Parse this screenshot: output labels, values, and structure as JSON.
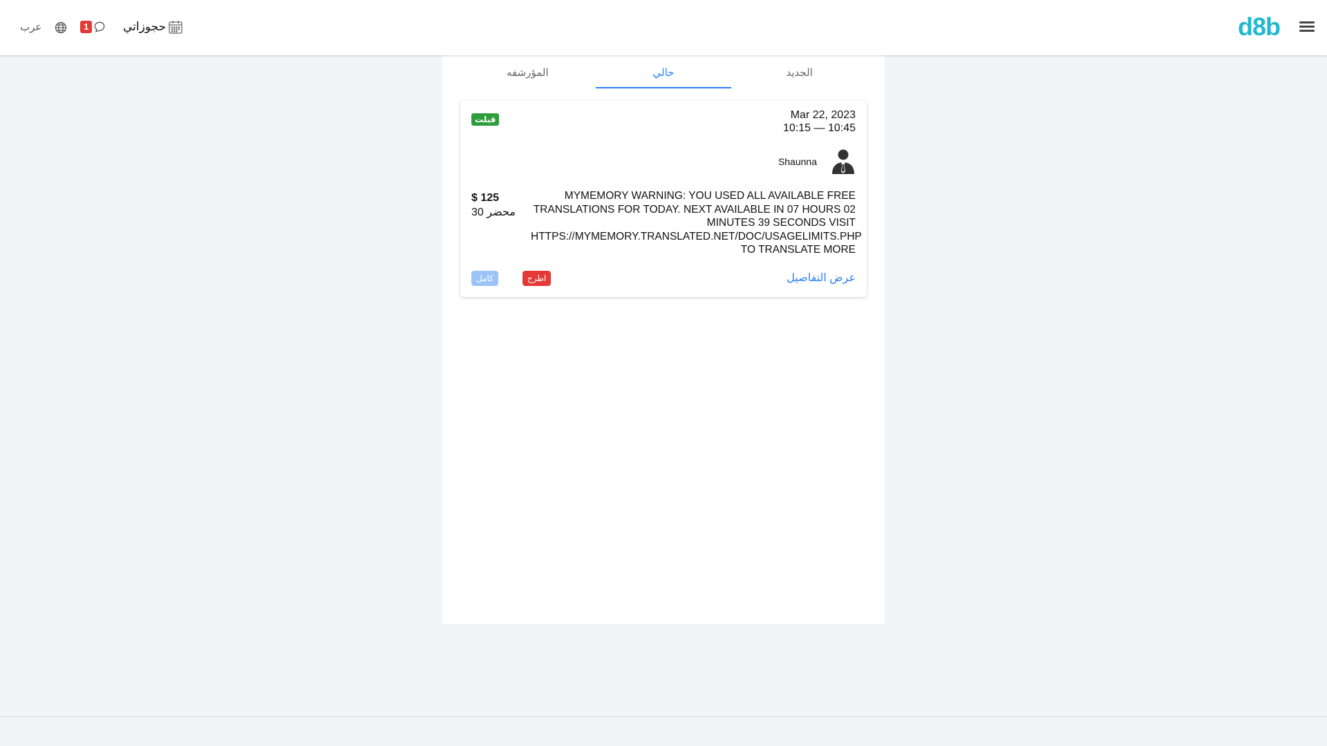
{
  "header": {
    "logo": "d8b",
    "language": "عرب",
    "notification_count": "1",
    "bookings_label": "حجوزاتي"
  },
  "tabs": [
    {
      "label": "الجديد",
      "active": false
    },
    {
      "label": "حالي",
      "active": true
    },
    {
      "label": "المؤرشفه",
      "active": false
    }
  ],
  "booking": {
    "date": "Mar 22, 2023",
    "time": "10:15 — 10:45",
    "status": "قبلت",
    "status_color": "#2e9e3c",
    "client_name": "Shaunna",
    "service": "MYMEMORY WARNING: YOU USED ALL AVAILABLE FREE TRANSLATIONS FOR TODAY. NEXT AVAILABLE IN 07 HOURS 02 MINUTES 39 SECONDS VISIT HTTPS://MYMEMORY.TRANSLATED.NET/DOC/USAGELIMITS.PHP TO TRANSLATE MORE",
    "price": "$ 125",
    "duration": "30 محضر",
    "details_link": "عرض التفاصيل",
    "reject_label": "اطرح",
    "complete_label": "كامل"
  },
  "colors": {
    "accent": "#2d7ff9",
    "logo": "#22b8cf",
    "danger": "#e53935",
    "disabled_blue": "#9cc4f8"
  }
}
